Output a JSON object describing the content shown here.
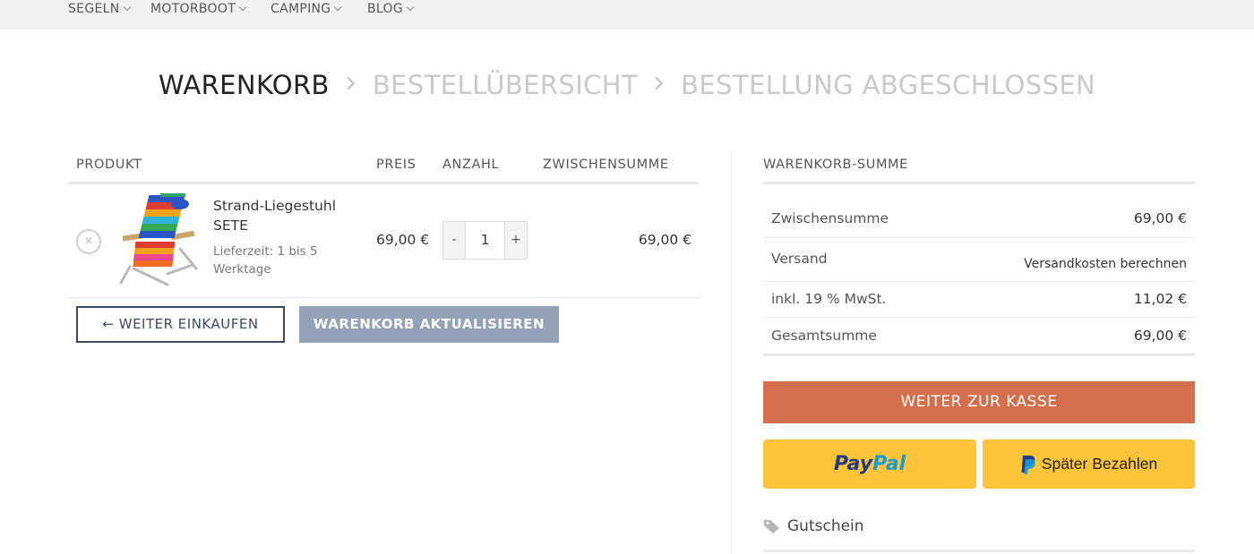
{
  "nav": {
    "items": [
      {
        "label": "SEGELN"
      },
      {
        "label": "MOTORBOOT"
      },
      {
        "label": "CAMPING"
      },
      {
        "label": "BLOG"
      }
    ]
  },
  "steps": {
    "cart": "WARENKORB",
    "overview": "BESTELLÜBERSICHT",
    "done": "BESTELLUNG ABGESCHLOSSEN"
  },
  "cart": {
    "headers": {
      "product": "PRODUKT",
      "price": "PREIS",
      "quantity": "ANZAHL",
      "subtotal": "ZWISCHENSUMME"
    },
    "items": [
      {
        "name": "Strand-Liegestuhl SETE",
        "delivery": "Lieferzeit: 1 bis 5 Werktage",
        "price": "69,00 €",
        "quantity": "1",
        "subtotal": "69,00 €"
      }
    ],
    "qty_minus": "-",
    "qty_plus": "+",
    "remove_symbol": "×",
    "continue_label": "← WEITER EINKAUFEN",
    "update_label": "WARENKORB AKTUALISIEREN"
  },
  "summary": {
    "title": "WARENKORB-SUMME",
    "subtotal_label": "Zwischensumme",
    "subtotal_value": "69,00 €",
    "shipping_label": "Versand",
    "shipping_value": "Versandkosten berechnen",
    "tax_label": "inkl. 19 % MwSt.",
    "tax_value": "11,02 €",
    "total_label": "Gesamtsumme",
    "total_value": "69,00 €",
    "checkout_label": "WEITER ZUR KASSE",
    "paypal_part1": "Pay",
    "paypal_part2": "Pal",
    "paylater_label": "Später Bezahlen",
    "coupon_label": "Gutschein"
  },
  "colors": {
    "checkout": "#d36f4c",
    "paypal": "#ffc439",
    "update_button": "#93a2b6",
    "continue_border": "#3b4a61"
  }
}
